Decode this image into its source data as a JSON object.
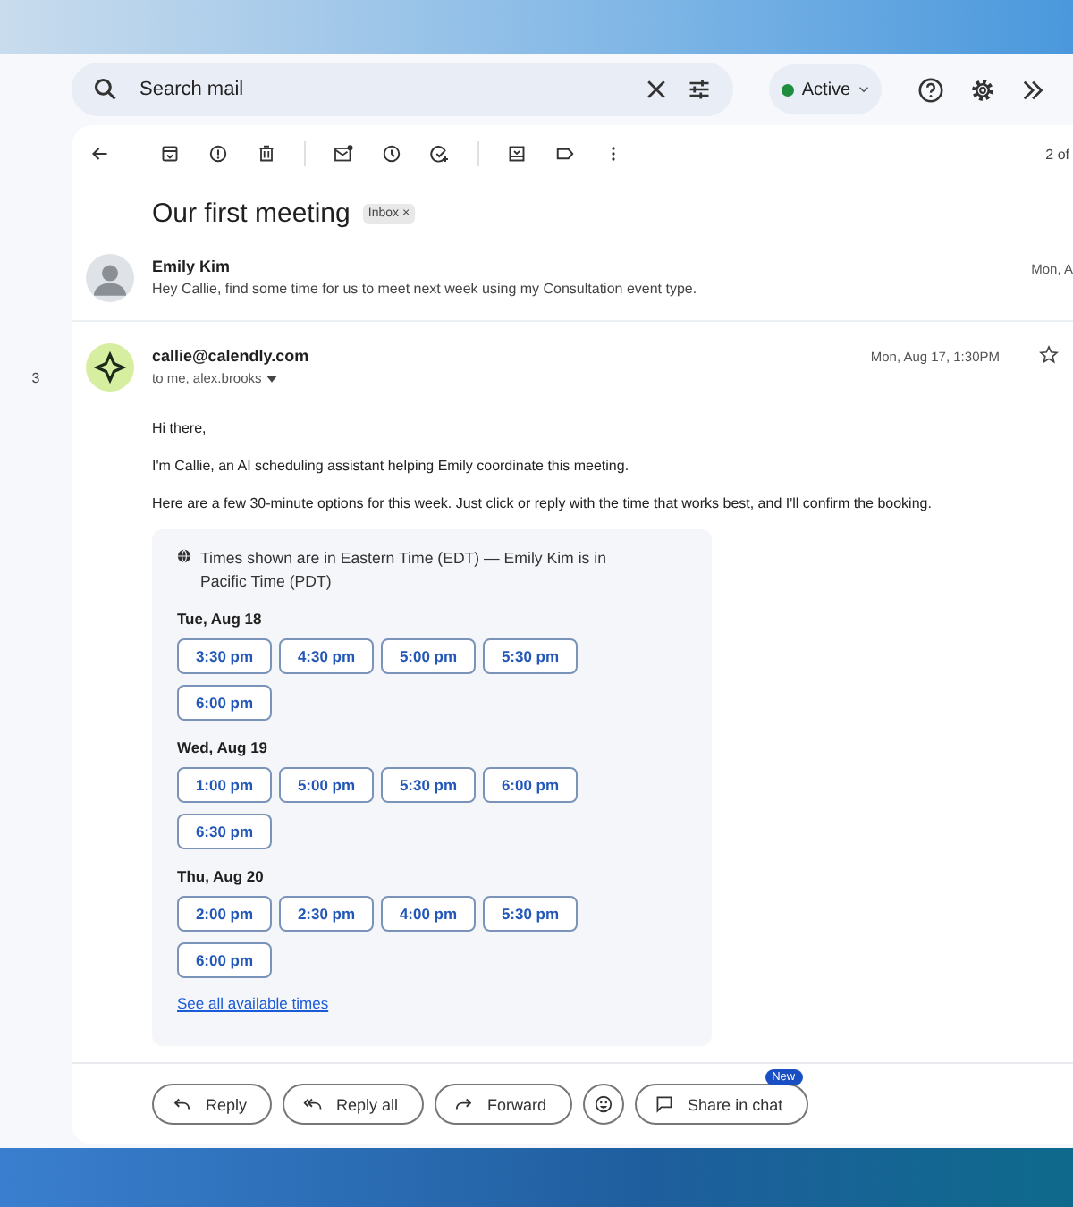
{
  "search": {
    "placeholder": "Search mail"
  },
  "status": {
    "label": "Active",
    "online": true
  },
  "left_rail": {
    "count": "3"
  },
  "toolbar": {
    "pagination": "2 of"
  },
  "thread": {
    "subject": "Our first meeting",
    "label": "Inbox",
    "label_close": "×"
  },
  "messages": [
    {
      "kind": "collapsed",
      "sender": "Emily Kim",
      "snippet": "Hey Callie, find some time for us to meet next week using my Consultation event type.",
      "date": "Mon, A"
    },
    {
      "kind": "expanded",
      "sender": "callie@calendly.com",
      "recipients": "to me, alex.brooks",
      "date": "Mon, Aug 17, 1:30PM",
      "starred": false,
      "paragraphs": [
        "Hi there,",
        "I'm Callie, an AI scheduling assistant helping Emily coordinate this meeting.",
        "Here are a few 30-minute options for this week. Just click or reply with the time that works best, and I'll confirm the booking."
      ],
      "scheduler": {
        "note": "Times shown are in Eastern Time (EDT) — Emily Kim is in Pacific Time (PDT)",
        "days": [
          {
            "label": "Tue, Aug 18",
            "slots": [
              "3:30 pm",
              "4:30 pm",
              "5:00 pm",
              "5:30 pm",
              "6:00 pm"
            ]
          },
          {
            "label": "Wed, Aug 19",
            "slots": [
              "1:00 pm",
              "5:00 pm",
              "5:30 pm",
              "6:00 pm",
              "6:30 pm"
            ]
          },
          {
            "label": "Thu, Aug 20",
            "slots": [
              "2:00 pm",
              "2:30 pm",
              "4:00 pm",
              "5:30 pm",
              "6:00 pm"
            ]
          }
        ],
        "link": "See all available times"
      }
    }
  ],
  "actions": [
    {
      "kind": "reply",
      "label": "Reply"
    },
    {
      "kind": "reply_all",
      "label": "Reply all"
    },
    {
      "kind": "forward",
      "label": "Forward"
    },
    {
      "kind": "emoji"
    },
    {
      "kind": "chat",
      "label": "Share in chat",
      "badge": "New"
    }
  ]
}
